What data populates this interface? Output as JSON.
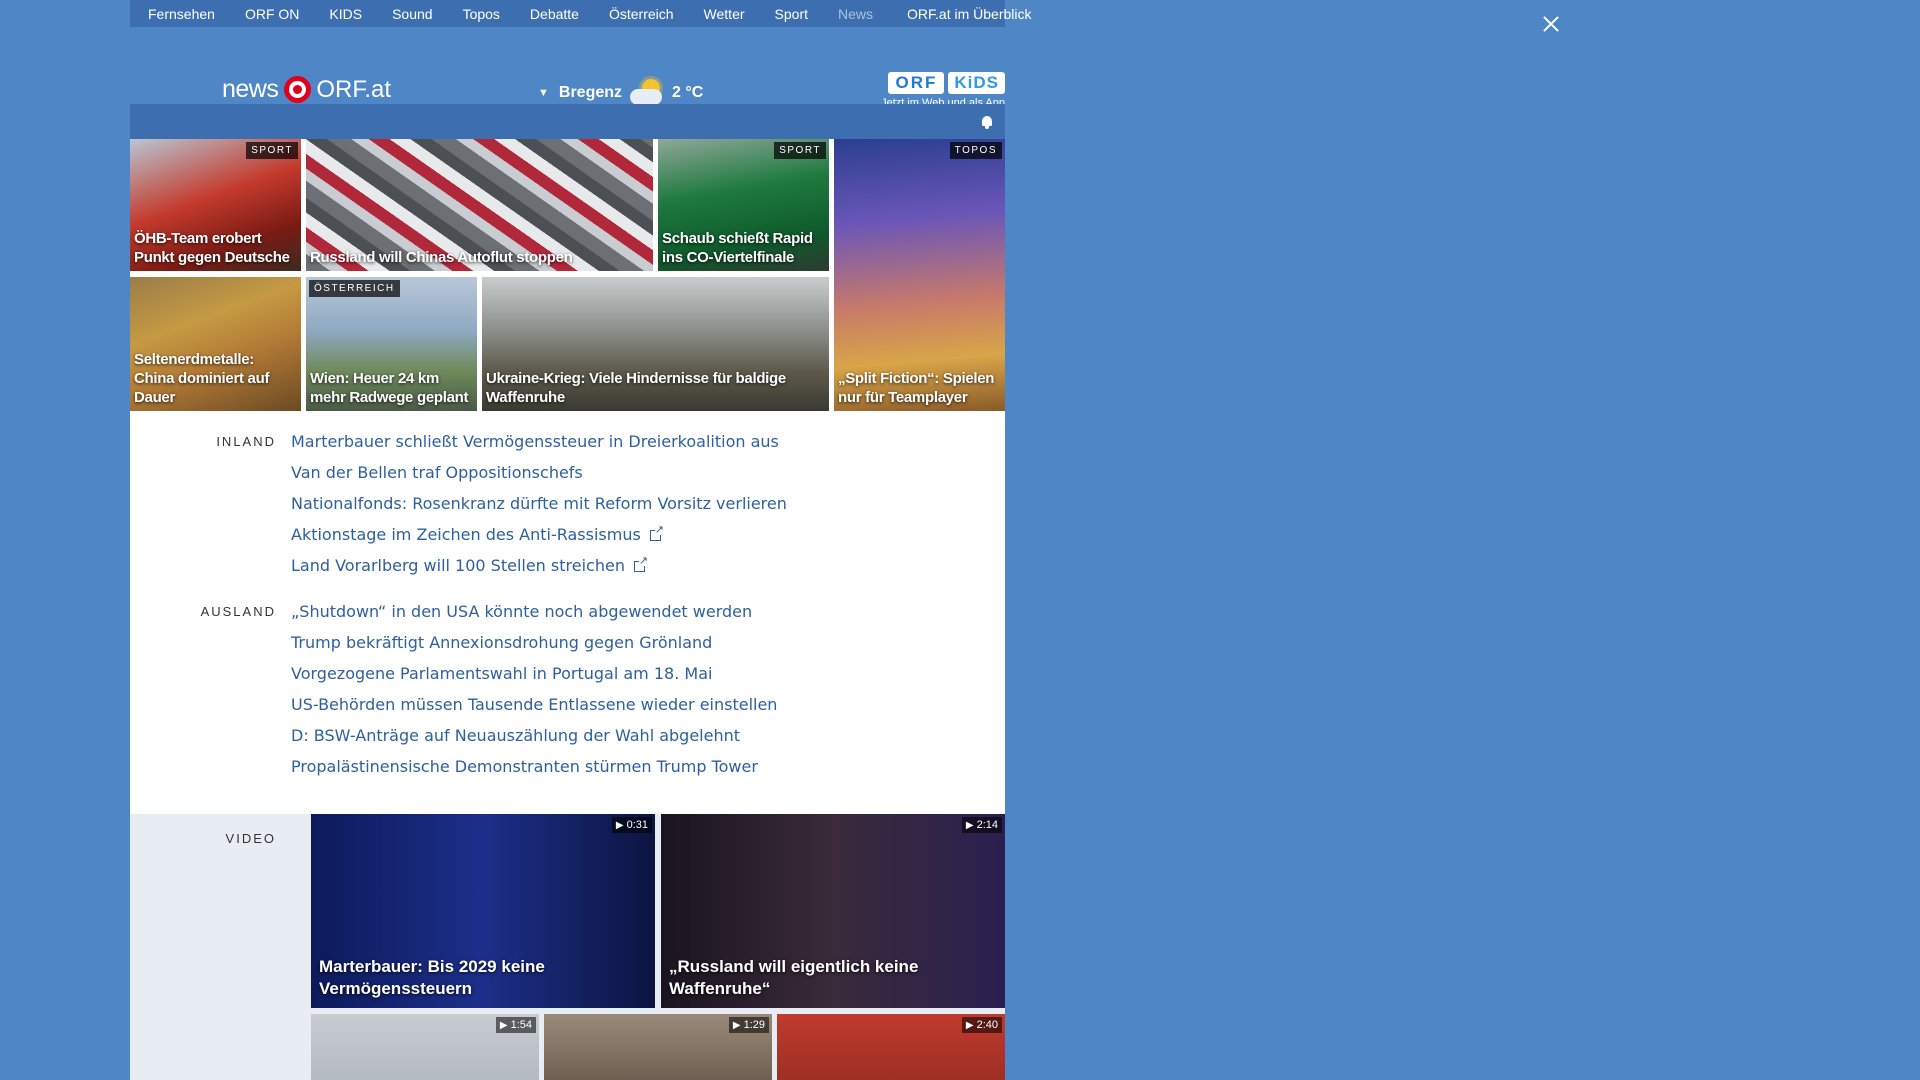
{
  "nav": {
    "items": [
      "Fernsehen",
      "ORF ON",
      "KIDS",
      "Sound",
      "Topos",
      "Debatte",
      "Österreich",
      "Wetter",
      "Sport",
      "News"
    ],
    "overview": "ORF.at im Überblick"
  },
  "header": {
    "logo_news": "news",
    "logo_orf": "ORF.at",
    "weather_city": "Bregenz",
    "weather_temp": "2 °C",
    "kids_orf": "ORF",
    "kids_kids": "KiDS",
    "kids_sub": "Jetzt im Web und als App"
  },
  "tiles": [
    {
      "caption": "ÖHB-Team erobert Punkt gegen Deutsche",
      "tag": "SPORT"
    },
    {
      "caption": "Russland will Chinas Autoflut stoppen",
      "tag": ""
    },
    {
      "caption": "Schaub schießt Rapid ins CO-Viertelfinale",
      "tag": "SPORT"
    },
    {
      "caption": "„Split Fiction“: Spielen nur für Teamplayer",
      "tag": "TOPOS"
    },
    {
      "caption": "Seltenerdmetalle: China dominiert auf Dauer",
      "tag": ""
    },
    {
      "caption": "Wien: Heuer 24 km mehr Radwege geplant",
      "tag": "ÖSTERREICH"
    },
    {
      "caption": "Ukraine-Krieg: Viele Hindernisse für baldige Waffenruhe",
      "tag": ""
    }
  ],
  "inland": {
    "label": "INLAND",
    "items": [
      "Marterbauer schließt Vermögenssteuer in Dreierkoalition aus",
      "Van der Bellen traf Oppositionschefs",
      "Nationalfonds: Rosenkranz dürfte mit Reform Vorsitz verlieren",
      "Aktionstage im Zeichen des Anti-Rassismus",
      "Land Vorarlberg will 100 Stellen streichen"
    ]
  },
  "ausland": {
    "label": "AUSLAND",
    "items": [
      "„Shutdown“ in den USA könnte noch abgewendet werden",
      "Trump bekräftigt Annexionsdrohung gegen Grönland",
      "Vorgezogene Parlamentswahl in Portugal am 18. Mai",
      "US-Behörden müssen Tausende Entlassene wieder einstellen",
      "D: BSW-Anträge auf Neuauszählung der Wahl abgelehnt",
      "Propalästinensische Demonstranten stürmen Trump Tower"
    ]
  },
  "video": {
    "label": "VIDEO",
    "items": [
      {
        "caption": "Marterbauer: Bis 2029 keine Vermögenssteuern",
        "duration": "0:31"
      },
      {
        "caption": "„Russland will eigentlich keine Waffenruhe“",
        "duration": "2:14"
      },
      {
        "caption": "",
        "duration": "1:54"
      },
      {
        "caption": "",
        "duration": "1:29"
      },
      {
        "caption": "",
        "duration": "2:40"
      }
    ]
  }
}
